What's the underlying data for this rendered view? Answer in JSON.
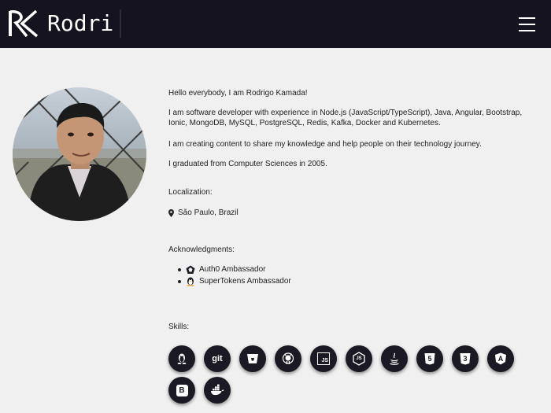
{
  "header": {
    "brand_name": "Rodri",
    "logo_icon": "rk-logo-icon",
    "menu_icon": "hamburger-icon",
    "colors": {
      "background": "#14131f",
      "text": "#ffffff"
    }
  },
  "profile": {
    "photo_alt": "profile-photo",
    "intro": "Hello everybody, I am Rodrigo Kamada!",
    "experience": "I am software developer with experience in Node.js (JavaScript/TypeScript), Java, Angular, Bootstrap, Ionic, MongoDB, MySQL, PostgreSQL, Redis, Kafka, Docker and Kubernetes.",
    "content": "I am creating content to share my knowledge and help people on their technology journey.",
    "graduation": "I graduated from Computer Sciences in 2005."
  },
  "localization": {
    "title": "Localization:",
    "city": "São Paulo, Brazil",
    "icon": "map-marker-icon"
  },
  "acknowledgments": {
    "title": "Acknowledgments:",
    "items": [
      {
        "label": "Auth0 Ambassador",
        "icon": "auth0-icon"
      },
      {
        "label": "SuperTokens Ambassador",
        "icon": "supertokens-icon"
      }
    ]
  },
  "skills": {
    "title": "Skills:",
    "items": [
      {
        "icon": "linux-icon"
      },
      {
        "icon": "git-icon",
        "label": "git"
      },
      {
        "icon": "bitbucket-icon"
      },
      {
        "icon": "github-icon"
      },
      {
        "icon": "javascript-icon",
        "label": "JS"
      },
      {
        "icon": "nodejs-icon",
        "label": "JS"
      },
      {
        "icon": "java-icon"
      },
      {
        "icon": "html5-icon",
        "label": "5"
      },
      {
        "icon": "css3-icon",
        "label": "3"
      },
      {
        "icon": "angular-icon",
        "label": "A"
      },
      {
        "icon": "bootstrap-icon",
        "label": "B"
      },
      {
        "icon": "docker-icon"
      }
    ]
  }
}
